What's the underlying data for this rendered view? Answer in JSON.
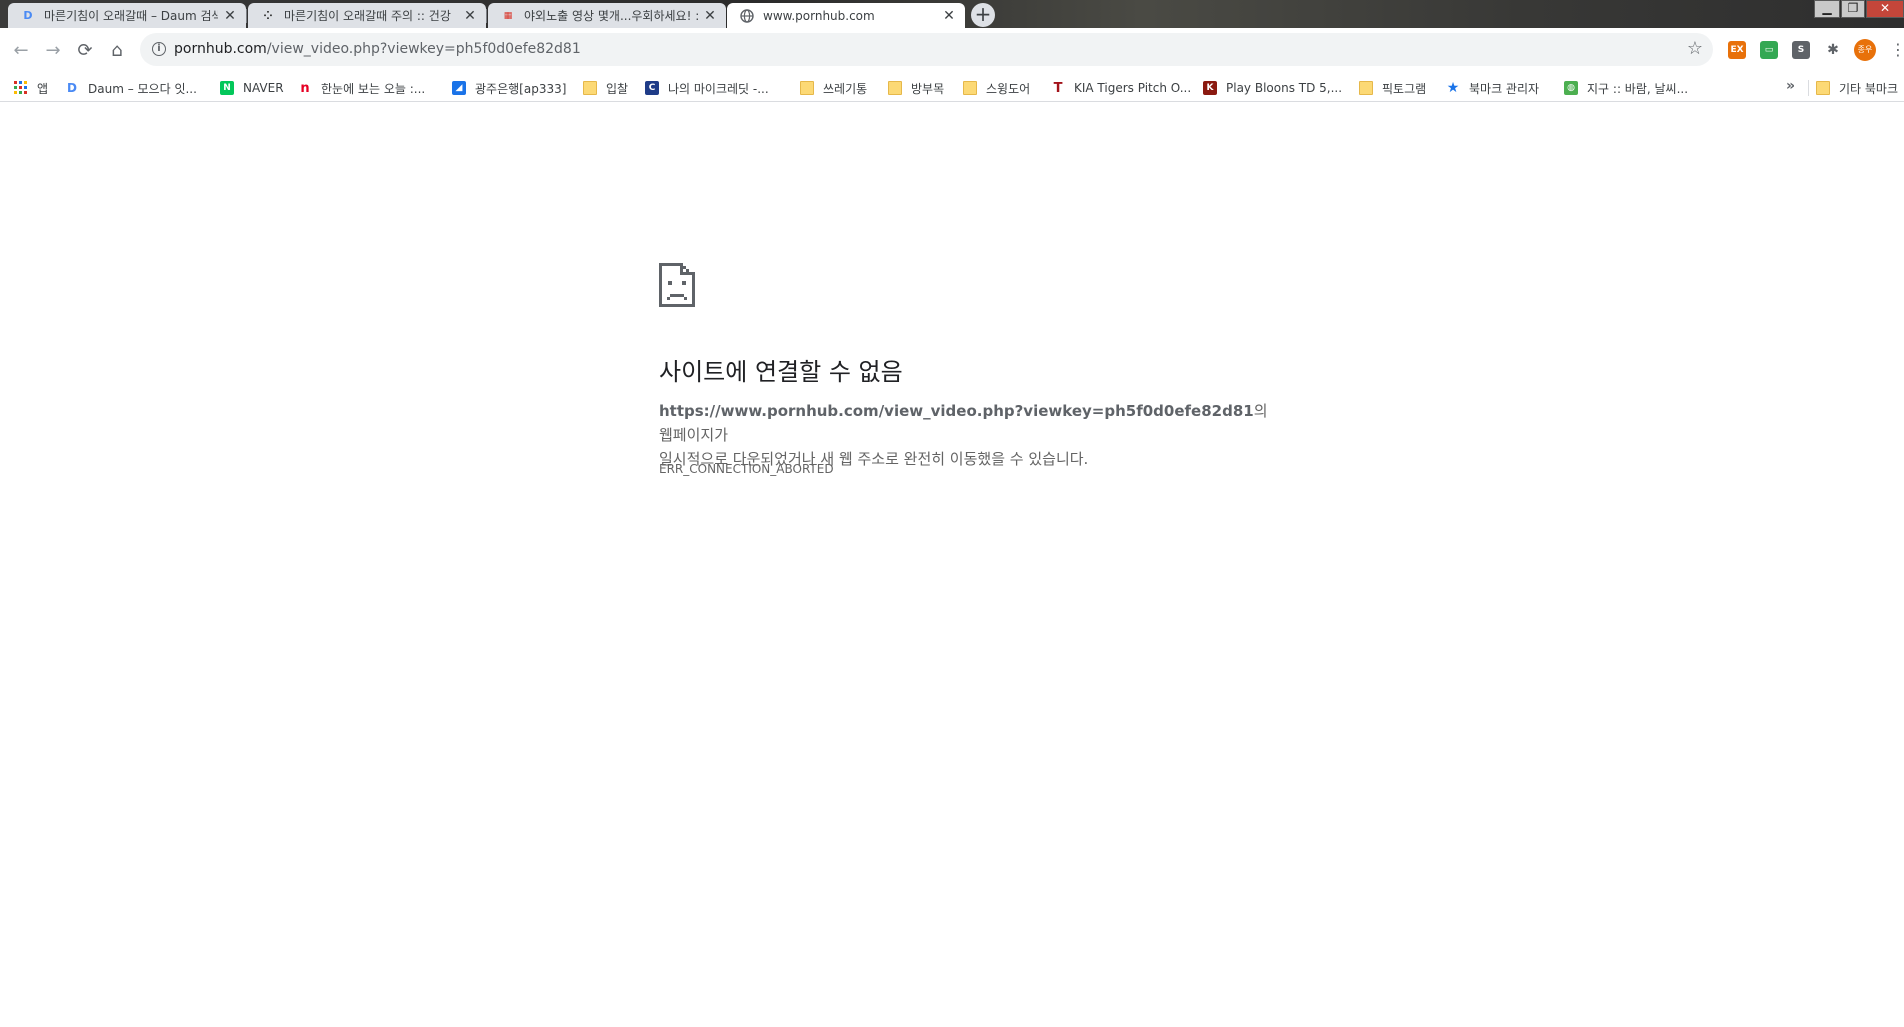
{
  "tabs": [
    {
      "title": "마른기침이 오래갈때 – Daum 검색",
      "favicon": "daum-icon",
      "close": "✕"
    },
    {
      "title": "마른기침이 오래갈때 주의 :: 건강",
      "favicon": "tistory-icon",
      "close": "✕"
    },
    {
      "title": "야외노출 영상 몇개...우회하세요! :",
      "favicon": "site-icon",
      "close": "✕"
    },
    {
      "title": "www.pornhub.com",
      "favicon": "globe-icon",
      "close": "✕",
      "active": true
    }
  ],
  "new_tab": "+",
  "window_controls": {
    "minimize": "▁",
    "maximize": "❐",
    "close": "✕"
  },
  "toolbar": {
    "back": "←",
    "forward": "→",
    "reload": "⟳",
    "home": "⌂",
    "url_host": "pornhub.com",
    "url_path": "/view_video.php?viewkey=ph5f0d0efe82d81",
    "star": "☆",
    "extensions": [
      {
        "name": "ex-extension-icon",
        "label": "EX",
        "color": "#e8710a"
      },
      {
        "name": "green-extension-icon",
        "label": "▭",
        "color": "#34a853"
      },
      {
        "name": "s-extension-icon",
        "label": "S",
        "color": "#5f6368"
      },
      {
        "name": "puzzle-extension-icon",
        "label": "✱",
        "color": "#5f6368"
      }
    ],
    "avatar_label": "종우",
    "menu": "⋮"
  },
  "bookmarks": [
    {
      "label": "앱",
      "icon": "apps-icon"
    },
    {
      "label": "Daum – 모으다 잇...",
      "icon": "daum-icon"
    },
    {
      "label": "NAVER",
      "icon": "naver-icon"
    },
    {
      "label": "한눈에 보는 오늘 :...",
      "icon": "nate-icon"
    },
    {
      "label": "광주은행[ap333]",
      "icon": "bank-icon"
    },
    {
      "label": "입찰",
      "icon": "folder-icon"
    },
    {
      "label": "나의 마이크레딧 -...",
      "icon": "credit-icon"
    },
    {
      "label": "쓰레기통",
      "icon": "folder-icon"
    },
    {
      "label": "방부목",
      "icon": "folder-icon"
    },
    {
      "label": "스윙도어",
      "icon": "folder-icon"
    },
    {
      "label": "KIA Tigers Pitch O...",
      "icon": "kia-icon"
    },
    {
      "label": "Play Bloons TD 5,...",
      "icon": "kongregate-icon"
    },
    {
      "label": "픽토그램",
      "icon": "folder-icon"
    },
    {
      "label": "북마크 관리자",
      "icon": "star-icon"
    },
    {
      "label": "지구 :: 바람, 날씨...",
      "icon": "earth-icon"
    }
  ],
  "bookmarks_more": "»",
  "other_bookmarks": "기타 북마크",
  "error": {
    "title": "사이트에 연결할 수 없음",
    "host": "https://www.pornhub.com/view_video.php?viewkey=ph5f0d0efe82d81",
    "message_after_host": "의 웹페이지가",
    "message_line2": "일시적으로 다운되었거나 새 웹 주소로 완전히 이동했을 수 있습니다.",
    "code": "ERR_CONNECTION_ABORTED"
  }
}
